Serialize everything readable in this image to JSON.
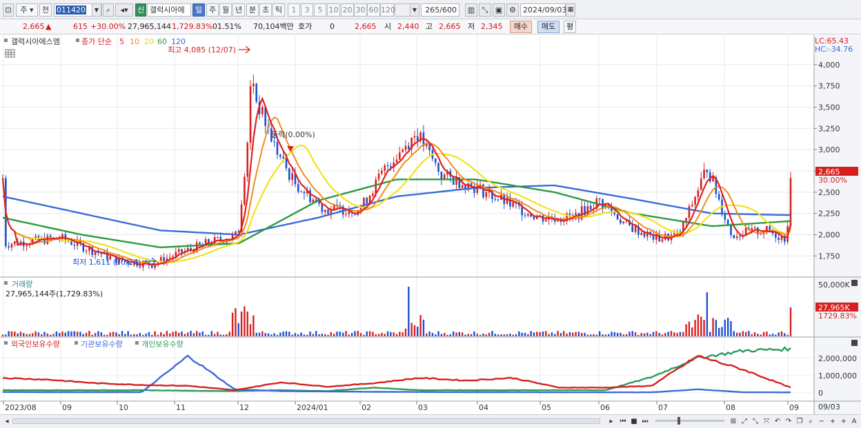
{
  "toolbar": {
    "market": "주",
    "prev": "전",
    "code": "011420",
    "tag": "신",
    "name": "갤럭시아에",
    "periods": [
      "일",
      "주",
      "월",
      "년",
      "분",
      "초",
      "틱"
    ],
    "active_period": "일",
    "nums": [
      "1",
      "3",
      "5",
      "10",
      "20",
      "30",
      "60",
      "120"
    ],
    "count": "265",
    "count_total": "/600",
    "date": "2024/09/03"
  },
  "quote": {
    "price": "2,665",
    "arrow": "▲",
    "change": "615",
    "change_pct": "+30.00%",
    "volume": "27,965,144",
    "volume_pct": "1,729.83%",
    "turnover": "01.51%",
    "amount": "70,104백만",
    "hoga_label": "호가",
    "hoga_val": "0",
    "hoga_price": "2,665",
    "open_label": "시",
    "open": "2,440",
    "high_label": "고",
    "high": "2,665",
    "low_label": "저",
    "low": "2,345",
    "buy": "매수",
    "sell": "매도",
    "avg": "평"
  },
  "price_panel": {
    "stock": "갤럭시아에스엠",
    "ma_title": "종가 단순",
    "ma": [
      {
        "p": "5",
        "color": "#e02020"
      },
      {
        "p": "10",
        "color": "#f08c1e"
      },
      {
        "p": "20",
        "color": "#f0e21e"
      },
      {
        "p": "60",
        "color": "#2a9a3c"
      },
      {
        "p": "120",
        "color": "#3a6ad8"
      }
    ],
    "lc": "LC:65.43",
    "hc": "HC:-34.76",
    "high_note": "최고 4,085 (12/07)",
    "low_note": "최저 1,611 (10/24)",
    "event_note": "등락(0.00%)",
    "last_price": "2,665",
    "last_pct": "30.00%",
    "yticks": [
      "4,000",
      "3,750",
      "3,500",
      "3,250",
      "3,000",
      "2,750",
      "2,500",
      "2,250",
      "2,000",
      "1,750"
    ]
  },
  "volume_panel": {
    "title": "거래량",
    "value": "27,965,144주(1,729.83%)",
    "ytick": "50,000K",
    "last": "27,965K",
    "last_pct": "1729.83%"
  },
  "holder_panel": {
    "legend": [
      "외국인보유수량",
      "기관보유수량",
      "개인보유수량"
    ],
    "legend_colors": [
      "#d62020",
      "#3a6ad8",
      "#2a9a5c"
    ],
    "yticks": [
      "2,000,000",
      "1,000,000",
      "0"
    ]
  },
  "x_axis": [
    "2023/08",
    "09",
    "10",
    "11",
    "12",
    "2024/01",
    "02",
    "03",
    "04",
    "05",
    "06",
    "07",
    "08",
    "09"
  ],
  "x_end": "09/03",
  "chart_data": {
    "type": "candlestick",
    "ylim": [
      1611,
      4085
    ],
    "anchors": [
      [
        "2023/08",
        1890
      ],
      [
        "09",
        1960
      ],
      [
        "10",
        1700
      ],
      [
        "10/24",
        1650
      ],
      [
        "11",
        1760
      ],
      [
        "11 mid",
        1900
      ],
      [
        "12",
        2000
      ],
      [
        "12/07",
        3700
      ],
      [
        "12 mid",
        3000
      ],
      [
        "12 end",
        2700
      ],
      [
        "2024/01",
        2600
      ],
      [
        "01 mid",
        2300
      ],
      [
        "02",
        2300
      ],
      [
        "02 mid",
        2800
      ],
      [
        "03",
        3200
      ],
      [
        "03 mid",
        2700
      ],
      [
        "04",
        2550
      ],
      [
        "04 mid",
        2350
      ],
      [
        "05",
        2200
      ],
      [
        "05 mid",
        2200
      ],
      [
        "06",
        2400
      ],
      [
        "06 mid",
        2100
      ],
      [
        "07",
        1950
      ],
      [
        "07 mid",
        2000
      ],
      [
        "08",
        2800
      ],
      [
        "08 mid",
        2000
      ],
      [
        "08 end",
        2050
      ],
      [
        "09",
        1950
      ],
      [
        "09/03",
        2665
      ]
    ],
    "ma120": [
      2450,
      2250,
      2050,
      2000,
      2200,
      2450,
      2550,
      2580,
      2420,
      2250,
      2230
    ],
    "ma60": [
      2200,
      2000,
      1850,
      1900,
      2400,
      2650,
      2650,
      2500,
      2250,
      2100,
      2160
    ]
  }
}
